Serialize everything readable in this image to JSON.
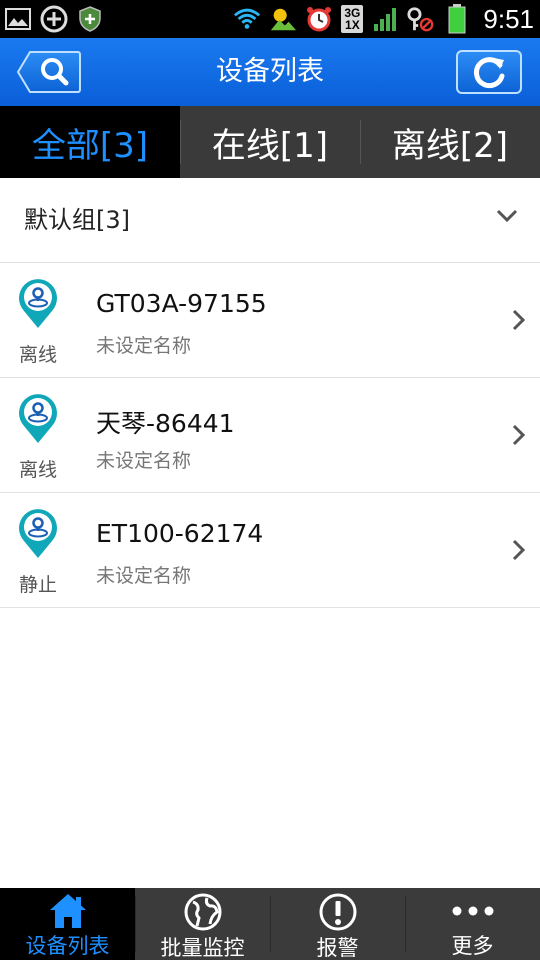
{
  "status_bar": {
    "time": "9:51",
    "network_top": "3G",
    "network_bottom": "1X"
  },
  "header": {
    "title": "设备列表"
  },
  "tabs": [
    {
      "label": "全部[3]"
    },
    {
      "label": "在线[1]"
    },
    {
      "label": "离线[2]"
    }
  ],
  "group": {
    "label": "默认组[3]"
  },
  "devices": [
    {
      "name": "GT03A-97155",
      "subtitle": "未设定名称",
      "status": "离线"
    },
    {
      "name": "天琴-86441",
      "subtitle": "未设定名称",
      "status": "离线"
    },
    {
      "name": "ET100-62174",
      "subtitle": "未设定名称",
      "status": "静止"
    }
  ],
  "bottom_nav": [
    {
      "label": "设备列表"
    },
    {
      "label": "批量监控"
    },
    {
      "label": "报警"
    },
    {
      "label": "更多"
    }
  ],
  "colors": {
    "header_blue": "#0a5fd8",
    "accent_blue": "#1e90ff",
    "pin_teal": "#10a8b8"
  }
}
